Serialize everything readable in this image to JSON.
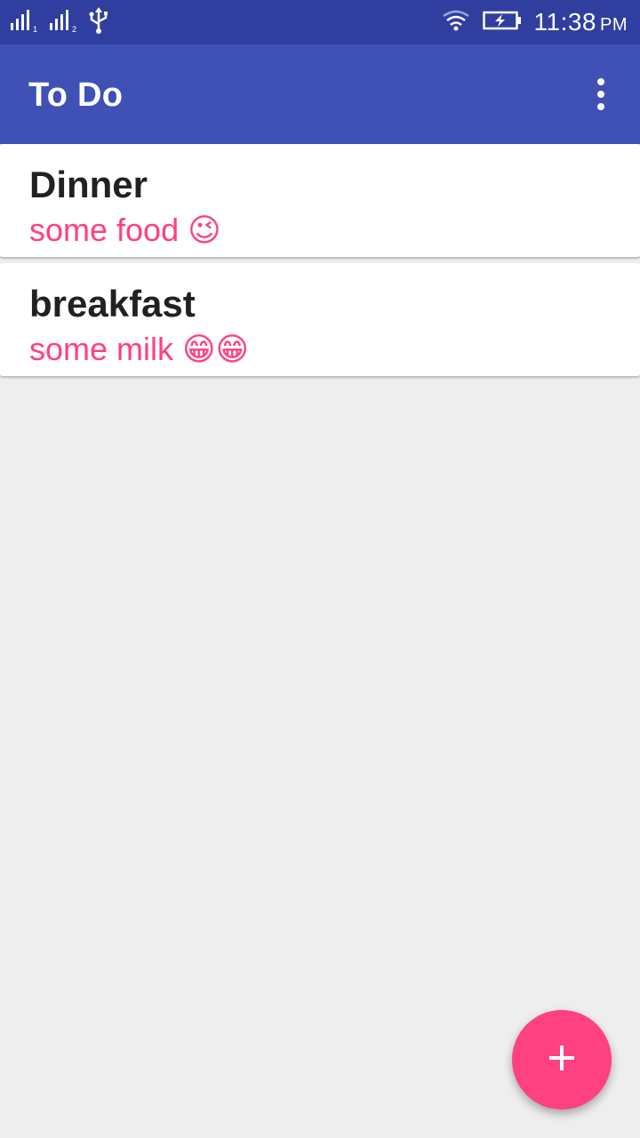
{
  "status_bar": {
    "time": "11:38",
    "ampm": "PM",
    "icons": [
      "signal-sim1-icon",
      "signal-sim2-icon",
      "usb-icon",
      "wifi-icon",
      "battery-charging-icon"
    ],
    "sim1_label": "1",
    "sim2_label": "2"
  },
  "app_bar": {
    "title": "To Do",
    "overflow_icon": "more-vert-icon"
  },
  "todos": [
    {
      "title": "Dinner",
      "note": "some food 😉"
    },
    {
      "title": "breakfast",
      "note": "some milk 😁😁"
    }
  ],
  "fab": {
    "icon": "add-icon"
  },
  "colors": {
    "status_bar": "#303f9f",
    "primary": "#3f51b5",
    "accent": "#ff4081",
    "background": "#eeeeee",
    "title_text": "#212121"
  }
}
